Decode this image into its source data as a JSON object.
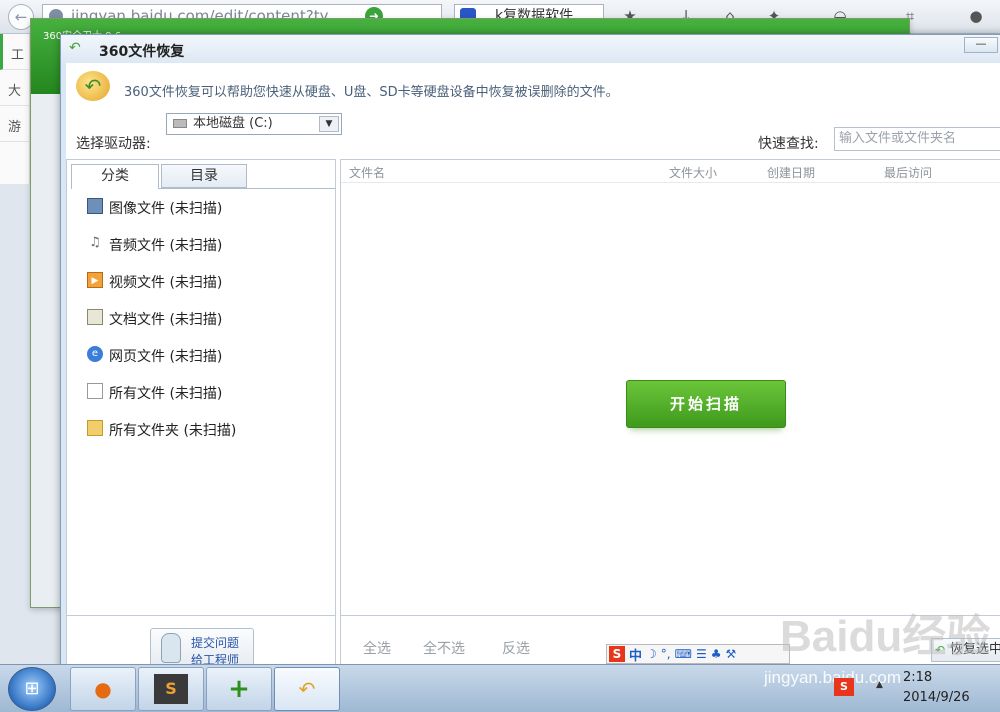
{
  "browser": {
    "url": "jingyan.baidu.com/edit/content?ty",
    "search": "k复数据软件",
    "bg_tab_rows": [
      "工",
      "大",
      "游"
    ]
  },
  "safe_guard": {
    "title": "360安全卫士 9.6"
  },
  "window": {
    "title": "360文件恢复",
    "minimize": "—",
    "banner_text": "360文件恢复可以帮助您快速从硬盘、U盘、SD卡等硬盘设备中恢复被误删除的文件。",
    "drive_label": "选择驱动器:",
    "drive_value": "本地磁盘 (C:)",
    "quick_label": "快速查找:",
    "quick_placeholder": "输入文件或文件夹名"
  },
  "tabs": [
    {
      "label": "分类"
    },
    {
      "label": "目录"
    }
  ],
  "categories": [
    {
      "label": "图像文件 (未扫描)",
      "icon": "image-icon"
    },
    {
      "label": "音频文件 (未扫描)",
      "icon": "music-note-icon"
    },
    {
      "label": "视频文件 (未扫描)",
      "icon": "video-icon"
    },
    {
      "label": "文档文件 (未扫描)",
      "icon": "document-icon"
    },
    {
      "label": "网页文件 (未扫描)",
      "icon": "web-icon"
    },
    {
      "label": "所有文件 (未扫描)",
      "icon": "file-icon"
    },
    {
      "label": "所有文件夹 (未扫描)",
      "icon": "folder-icon"
    }
  ],
  "columns": [
    "文件名",
    "文件大小",
    "创建日期",
    "最后访问"
  ],
  "scan_button": "开始扫描",
  "footer": {
    "select_all": "全选",
    "select_none": "全不选",
    "invert": "反选",
    "restore": "恢复选中",
    "submit_line1": "提交问题",
    "submit_line2": "给工程师"
  },
  "ime": {
    "logo": "S",
    "mode": "中"
  },
  "taskbar": {
    "time": "2:18",
    "date": "2014/9/26"
  },
  "watermark": {
    "logo": "Baidu经验",
    "url": "jingyan.baidu.com"
  },
  "colors": {
    "accent_green": "#3f9a1d",
    "link_blue": "#2754a8"
  }
}
